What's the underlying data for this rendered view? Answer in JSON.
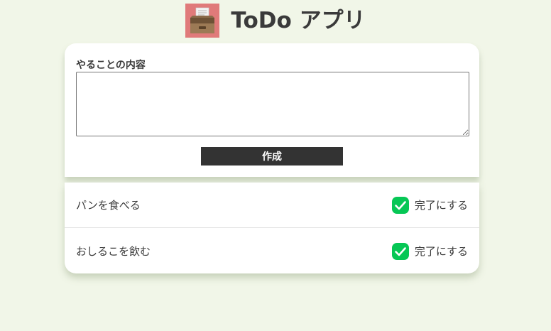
{
  "header": {
    "title": "ToDo アプリ",
    "logo_icon": "cabinet-drawer-icon",
    "logo_bg": "#e07a7a"
  },
  "form": {
    "label": "やることの内容",
    "textarea_value": "",
    "submit_label": "作成"
  },
  "todos": [
    {
      "text": "パンを食べる",
      "action_label": "完了にする",
      "action_icon": "check-circle-icon"
    },
    {
      "text": "おしるこを飲む",
      "action_label": "完了にする",
      "action_icon": "check-circle-icon"
    }
  ],
  "colors": {
    "background": "#f1f6e8",
    "card": "#ffffff",
    "button": "#333333",
    "check": "#06c755"
  }
}
